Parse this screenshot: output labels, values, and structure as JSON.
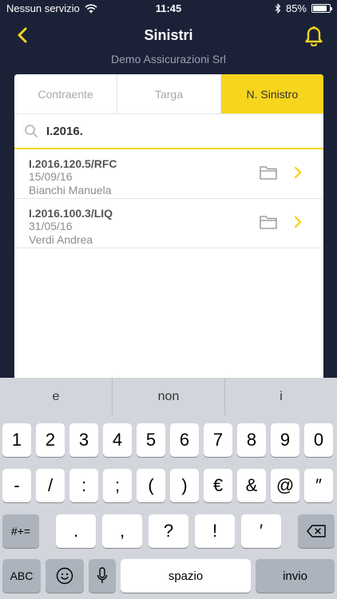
{
  "status": {
    "carrier": "Nessun servizio",
    "time": "11:45",
    "battery": "85%",
    "battery_level": 0.85
  },
  "nav": {
    "title": "Sinistri",
    "back_icon": "chevron-left-icon",
    "bell_icon": "bell-icon",
    "accent": "#f7d51d"
  },
  "company": "Demo Assicurazioni Srl",
  "tabs": [
    {
      "label": "Contraente",
      "active": false
    },
    {
      "label": "Targa",
      "active": false
    },
    {
      "label": "N. Sinistro",
      "active": true
    }
  ],
  "search": {
    "value": "I.2016.",
    "placeholder": ""
  },
  "claims": [
    {
      "code": "I.2016.120.5/RFC",
      "date": "15/09/16",
      "name": "Bianchi Manuela"
    },
    {
      "code": "I.2016.100.3/LIQ",
      "date": "31/05/16",
      "name": "Verdi Andrea"
    }
  ],
  "keyboard": {
    "suggestions": [
      "e",
      "non",
      "i"
    ],
    "row1": [
      "1",
      "2",
      "3",
      "4",
      "5",
      "6",
      "7",
      "8",
      "9",
      "0"
    ],
    "row2": [
      "-",
      "/",
      ":",
      ";",
      "(",
      ")",
      "€",
      "&",
      "@",
      "″"
    ],
    "row3_left": "#+=",
    "row3": [
      ".",
      ",",
      "?",
      "!",
      "′"
    ],
    "abc": "ABC",
    "space": "spazio",
    "enter": "invio"
  }
}
